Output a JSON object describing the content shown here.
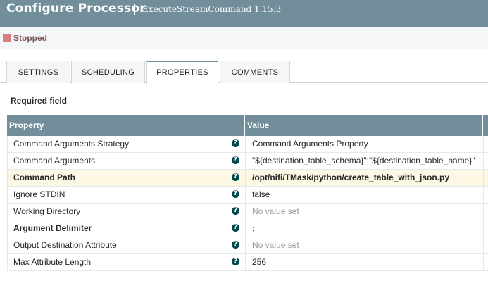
{
  "header": {
    "title": "Configure Processor",
    "subtitle": "ExecuteStreamCommand 1.15.3"
  },
  "status": {
    "text": "Stopped",
    "color": "#d4807e"
  },
  "tabs": [
    {
      "label": "SETTINGS",
      "active": false
    },
    {
      "label": "SCHEDULING",
      "active": false
    },
    {
      "label": "PROPERTIES",
      "active": true
    },
    {
      "label": "COMMENTS",
      "active": false
    }
  ],
  "required_label": "Required field",
  "table": {
    "headers": {
      "property": "Property",
      "value": "Value"
    },
    "rows": [
      {
        "property": "Command Arguments Strategy",
        "value": "Command Arguments Property",
        "required": false,
        "empty": false
      },
      {
        "property": "Command Arguments",
        "value": "\"${destination_table_schema}\";\"${destination_table_name}\"",
        "required": false,
        "empty": false
      },
      {
        "property": "Command Path",
        "value": "/opt/nifi/TMask/python/create_table_with_json.py",
        "required": true,
        "empty": false
      },
      {
        "property": "Ignore STDIN",
        "value": "false",
        "required": false,
        "empty": false
      },
      {
        "property": "Working Directory",
        "value": "No value set",
        "required": false,
        "empty": true
      },
      {
        "property": "Argument Delimiter",
        "value": ";",
        "required": true,
        "empty": false
      },
      {
        "property": "Output Destination Attribute",
        "value": "No value set",
        "required": false,
        "empty": true
      },
      {
        "property": "Max Attribute Length",
        "value": "256",
        "required": false,
        "empty": false
      }
    ]
  },
  "colors": {
    "header_bg": "#728e9b",
    "highlight_row": "#fcf8e3",
    "help_icon": "#004849"
  }
}
